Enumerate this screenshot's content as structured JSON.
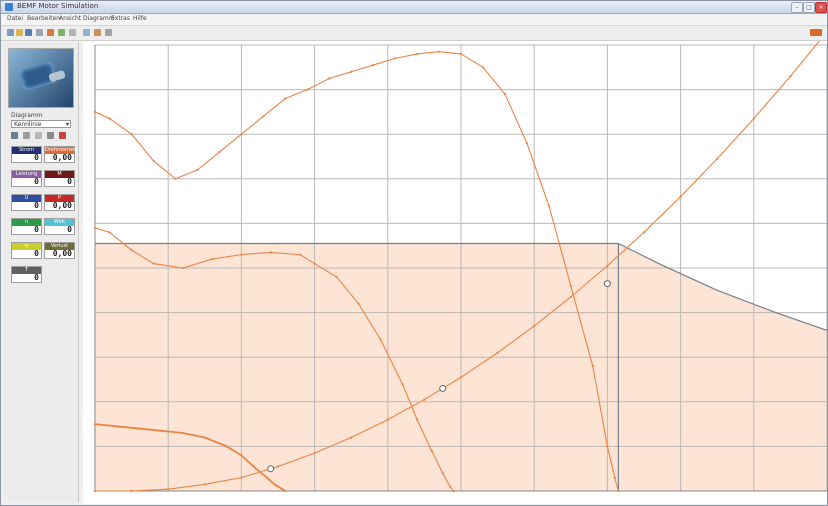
{
  "window": {
    "title": "BEMF Motor Simulation",
    "buttons": [
      "–",
      "□",
      "×"
    ]
  },
  "menu": [
    "Datei",
    "Bearbeiten",
    "Ansicht",
    "Diagramm",
    "Extras",
    "Hilfe"
  ],
  "sidebar": {
    "selector_label": "Diagramm",
    "selector_value": "Kennlinie",
    "tiles": [
      {
        "label": "Strom",
        "value": "0",
        "color": "#232f70"
      },
      {
        "label": "Drehmoment",
        "value": "0,00",
        "color": "#d86c39"
      },
      {
        "label": "Leistung",
        "value": "0",
        "color": "#8e5aa0"
      },
      {
        "label": "M",
        "value": "0",
        "color": "#6f1818"
      },
      {
        "label": "U",
        "value": "0",
        "color": "#2c4fa0"
      },
      {
        "label": "P",
        "value": "0,00",
        "color": "#c92828"
      },
      {
        "label": "n",
        "value": "0",
        "color": "#2c9a48"
      },
      {
        "label": "Wirk",
        "value": "0",
        "color": "#55c3d6"
      },
      {
        "label": "η",
        "value": "0",
        "color": "#c7cf2b"
      },
      {
        "label": "Verlust",
        "value": "0,00",
        "color": "#6d6b39"
      },
      {
        "label": "T",
        "value": "0",
        "color": "#5f5f5f"
      }
    ]
  },
  "chart_data": {
    "type": "line",
    "title": "",
    "xlabel": "",
    "ylabel": "",
    "xlim": [
      0,
      10
    ],
    "ylim": [
      0,
      10
    ],
    "grid": true,
    "colors": {
      "curve": "#e98445",
      "fill": "#fde4d4",
      "envelope": "#737f8c",
      "grid": "#b9b9b9"
    },
    "series": [
      {
        "x": [
          0,
          0.2,
          0.5,
          0.8,
          1.1,
          1.4,
          1.7,
          2.0,
          2.3,
          2.6,
          2.9,
          3.2,
          3.5,
          3.8,
          4.1,
          4.4,
          4.7,
          5.0,
          5.3,
          5.6,
          5.9,
          6.2,
          6.5,
          6.8,
          7.0,
          7.1,
          7.15
        ],
        "y": [
          8.5,
          8.35,
          8.0,
          7.4,
          7.0,
          7.2,
          7.6,
          8.0,
          8.4,
          8.8,
          9.0,
          9.25,
          9.4,
          9.55,
          9.7,
          9.8,
          9.85,
          9.8,
          9.5,
          8.9,
          7.8,
          6.4,
          4.6,
          2.8,
          1.0,
          0.3,
          0
        ]
      },
      {
        "x": [
          0,
          0.2,
          0.5,
          0.8,
          1.2,
          1.6,
          2.0,
          2.4,
          2.8,
          3.0,
          3.3,
          3.6,
          3.9,
          4.2,
          4.4,
          4.6,
          4.75,
          4.85,
          4.9
        ],
        "y": [
          5.9,
          5.8,
          5.4,
          5.1,
          5.0,
          5.2,
          5.3,
          5.35,
          5.3,
          5.1,
          4.8,
          4.2,
          3.4,
          2.4,
          1.6,
          0.9,
          0.4,
          0.1,
          0
        ]
      },
      {
        "x": [
          0,
          0.3,
          0.6,
          0.9,
          1.2,
          1.5,
          1.8,
          2.0,
          2.2,
          2.35,
          2.45,
          2.55,
          2.6
        ],
        "y": [
          1.5,
          1.45,
          1.4,
          1.35,
          1.3,
          1.2,
          1.0,
          0.8,
          0.5,
          0.3,
          0.15,
          0.05,
          0
        ]
      },
      {
        "x": [
          0,
          0.5,
          1.0,
          1.5,
          2.0,
          2.5,
          3.0,
          3.5,
          4.0,
          4.5,
          5.0,
          5.5,
          6.0,
          6.5,
          7.0,
          7.5,
          8.0,
          8.5,
          9.0,
          9.5,
          10
        ],
        "y": [
          0,
          0,
          0.04,
          0.15,
          0.3,
          0.55,
          0.85,
          1.2,
          1.6,
          2.05,
          2.55,
          3.1,
          3.7,
          4.35,
          5.05,
          5.8,
          6.6,
          7.45,
          8.35,
          9.3,
          10.3
        ]
      }
    ],
    "envelope": {
      "x": [
        0,
        7.1,
        7.15,
        7.7,
        8.5,
        9.3,
        10
      ],
      "y": [
        5.55,
        5.55,
        5.55,
        5.1,
        4.5,
        4.0,
        3.6
      ]
    },
    "markers": [
      {
        "x": 2.4,
        "y": 0.5
      },
      {
        "x": 4.75,
        "y": 2.3
      },
      {
        "x": 7.0,
        "y": 4.65
      }
    ]
  }
}
